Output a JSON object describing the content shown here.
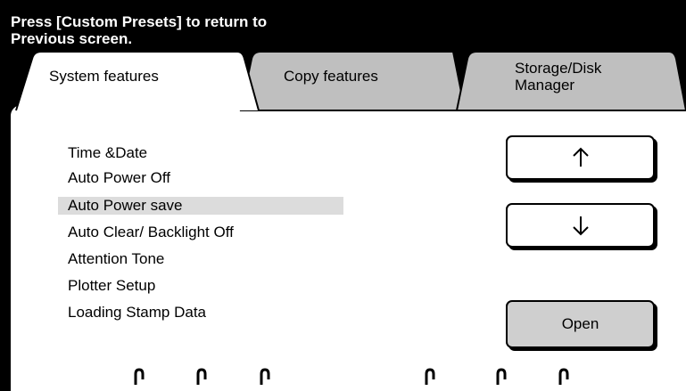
{
  "header": {
    "line1": "Press [Custom Presets] to return to",
    "line2": "Previous screen."
  },
  "tabs": [
    {
      "label_lines": [
        "System features"
      ],
      "active": true
    },
    {
      "label_lines": [
        "Copy features"
      ],
      "active": false
    },
    {
      "label_lines": [
        "Storage/Disk",
        "Manager"
      ],
      "active": false
    }
  ],
  "features": {
    "items": [
      {
        "label": "Time &Date",
        "selected": false
      },
      {
        "label": "Auto Power Off",
        "selected": false
      },
      {
        "label": "Auto Power save",
        "selected": true
      },
      {
        "label": "Auto Clear/ Backlight Off",
        "selected": false
      },
      {
        "label": "Attention Tone",
        "selected": false
      },
      {
        "label": "Plotter Setup",
        "selected": false
      },
      {
        "label": "Loading Stamp Data",
        "selected": false
      }
    ]
  },
  "buttons": {
    "scroll_up_icon": "arrow-up-icon",
    "scroll_down_icon": "arrow-down-icon",
    "open_label": "Open"
  },
  "footer": {
    "icon": "pin-hook-icon",
    "icon_count": 6
  },
  "colors": {
    "background": "#000000",
    "panel": "#ffffff",
    "inactive_tab": "#bfbfbf",
    "selected_row": "#dcdcdc",
    "open_button": "#cfcfcf"
  }
}
